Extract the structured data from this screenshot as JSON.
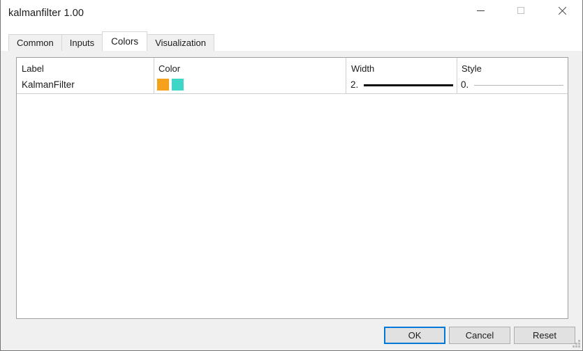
{
  "window": {
    "title": "kalmanfilter 1.00",
    "controls": [
      {
        "name": "minimize",
        "glyph": "minimize-icon"
      },
      {
        "name": "maximize",
        "glyph": "maximize-icon"
      },
      {
        "name": "close",
        "glyph": "close-icon"
      }
    ]
  },
  "tabs": [
    {
      "label": "Common",
      "selected": false
    },
    {
      "label": "Inputs",
      "selected": false
    },
    {
      "label": "Colors",
      "selected": true
    },
    {
      "label": "Visualization",
      "selected": false
    }
  ],
  "table": {
    "columns": [
      "Label",
      "Color",
      "Width",
      "Style"
    ],
    "rows": [
      {
        "label": "KalmanFilter",
        "colors": [
          "#F5A11B",
          "#3FD6C8"
        ],
        "width_value": "2.",
        "style_value": "0."
      }
    ]
  },
  "footer": {
    "ok_label": "OK",
    "cancel_label": "Cancel",
    "reset_label": "Reset"
  },
  "colors": {
    "swatch_orange": "#F5A11B",
    "swatch_teal": "#3FD6C8",
    "focus_blue": "#0078D7",
    "window_bg": "#F0F0F0",
    "panel_bg": "#FFFFFF",
    "width_line": "#0B0B0B",
    "style_line": "#B6B6B6"
  }
}
